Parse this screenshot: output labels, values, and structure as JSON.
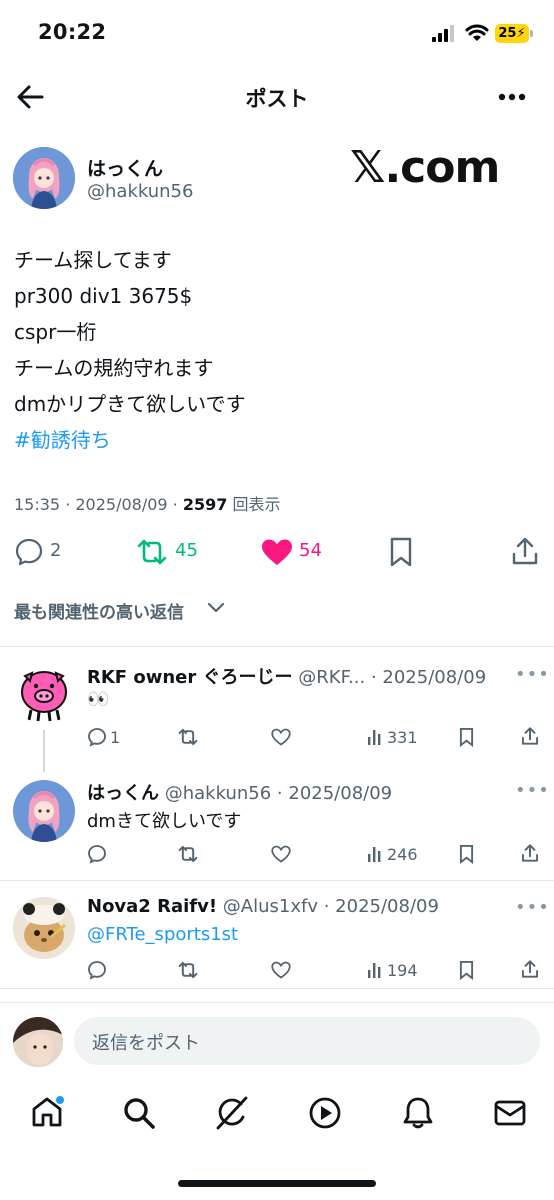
{
  "status_bar": {
    "time": "20:22",
    "battery": "25"
  },
  "header": {
    "title": "ポスト"
  },
  "post": {
    "author_name": "はっくん",
    "author_handle": "@hakkun56",
    "watermark": "𝕏.com",
    "lines": [
      "チーム探してます",
      "pr300 div1 3675$",
      "cspr一桁",
      "チームの規約守れます",
      "dmかリプきて欲しいです"
    ],
    "hashtag": "#勧誘待ち",
    "timestamp": "15:35 · 2025/08/09 · ",
    "views": "2597",
    "views_label": "回表示",
    "replies": "2",
    "reposts": "45",
    "likes": "54",
    "colors": {
      "repost": "#00ba7c",
      "like": "#f91880",
      "link": "#1d9bf0"
    }
  },
  "sort": {
    "label": "最も関連性の高い返信"
  },
  "replies": [
    {
      "name": "RKF owner ぐろーじー",
      "handle": "@RKF...",
      "date": "· 2025/08/09",
      "text": "👀",
      "replies": "1",
      "views": "331"
    },
    {
      "name": "はっくん",
      "handle": "@hakkun56",
      "date": "· 2025/08/09",
      "text": "dmきて欲しいです",
      "replies": "",
      "views": "246"
    },
    {
      "name": "Nova2 Raifv!",
      "handle": "@Alus1xfv",
      "date": "· 2025/08/09",
      "text": "@FRTe_sports1st",
      "replies": "",
      "views": "194"
    }
  ],
  "composer": {
    "placeholder": "返信をポスト"
  },
  "icons": {
    "back": "arrow-left-icon",
    "more": "more-horizontal-icon",
    "nav": [
      "home-icon",
      "search-icon",
      "grok-icon",
      "video-icon",
      "bell-icon",
      "mail-icon"
    ]
  }
}
